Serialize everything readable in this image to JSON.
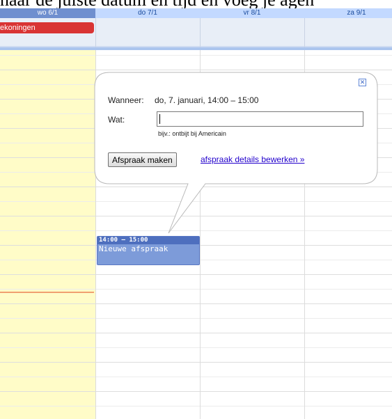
{
  "caption": "naar de juiste datum en tijd en voeg je agen",
  "columns": [
    {
      "label": "wo 6/1",
      "today": true
    },
    {
      "label": "do 7/1"
    },
    {
      "label": "vr 8/1"
    },
    {
      "label": "za 9/1"
    }
  ],
  "allday_event": {
    "title": "ekoningen"
  },
  "event": {
    "time": "14:00 – 15:00",
    "title": "Nieuwe afspraak"
  },
  "popup": {
    "when_label": "Wanneer:",
    "when_value": "do, 7. januari, 14:00 – 15:00",
    "what_label": "Wat:",
    "what_value": "",
    "hint": "bijv.: ontbijt bij Americain",
    "make_button": "Afspraak maken",
    "details_link": "afspraak details bewerken »",
    "close_symbol": "✕"
  },
  "colors": {
    "today_bg": "#fffcc8",
    "header_bg": "#c3d9ff",
    "event_bg": "#7d9bd9",
    "allday_event_bg": "#d93434",
    "now_line": "#f0a070",
    "link": "#2200cc"
  }
}
